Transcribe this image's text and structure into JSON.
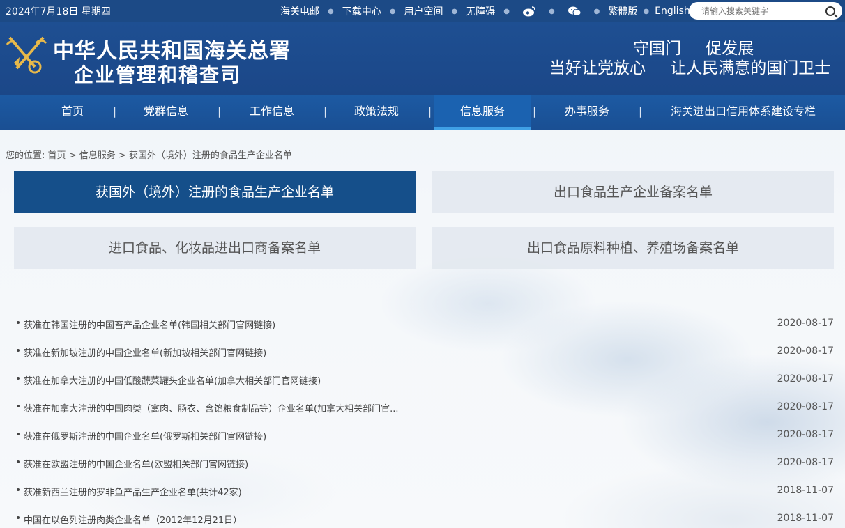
{
  "topbar": {
    "date": "2024年7月18日 星期四",
    "links": [
      "海关电邮",
      "下载中心",
      "用户空间",
      "无障碍"
    ],
    "traditional": "繁體版",
    "english": "English",
    "search_placeholder": "请输入搜索关键字"
  },
  "header": {
    "title_line1": "中华人民共和国海关总署",
    "title_line2": "企业管理和稽查司",
    "slogan_line1": "守国门 促发展",
    "slogan_line2": "当好让党放心 让人民满意的国门卫士"
  },
  "nav": {
    "items": [
      "首页",
      "党群信息",
      "工作信息",
      "政策法规",
      "信息服务",
      "办事服务",
      "海关进出口信用体系建设专栏"
    ],
    "active": "信息服务"
  },
  "breadcrumb": {
    "prefix": "您的位置:",
    "items": [
      "首页",
      "信息服务",
      "获国外（境外）注册的食品生产企业名单"
    ]
  },
  "categories": [
    "获国外（境外）注册的食品生产企业名单",
    "出口食品生产企业备案名单",
    "进口食品、化妆品进出口商备案名单",
    "出口食品原料种植、养殖场备案名单"
  ],
  "list": [
    {
      "title": "获准在韩国注册的中国畜产品企业名单(韩国相关部门官网链接)",
      "date": "2020-08-17"
    },
    {
      "title": "获准在新加坡注册的中国企业名单(新加坡相关部门官网链接)",
      "date": "2020-08-17"
    },
    {
      "title": "获准在加拿大注册的中国低酸蔬菜罐头企业名单(加拿大相关部门官网链接)",
      "date": "2020-08-17"
    },
    {
      "title": "获准在加拿大注册的中国肉类（禽肉、肠衣、含馅粮食制品等）企业名单(加拿大相关部门官...",
      "date": "2020-08-17"
    },
    {
      "title": "获准在俄罗斯注册的中国企业名单(俄罗斯相关部门官网链接)",
      "date": "2020-08-17"
    },
    {
      "title": "获准在欧盟注册的中国企业名单(欧盟相关部门官网链接)",
      "date": "2020-08-17"
    },
    {
      "title": "获准新西兰注册的罗非鱼产品生产企业名单(共计42家)",
      "date": "2018-11-07"
    },
    {
      "title": "中国在以色列注册肉类企业名单（2012年12月21日）",
      "date": "2018-11-07"
    }
  ]
}
